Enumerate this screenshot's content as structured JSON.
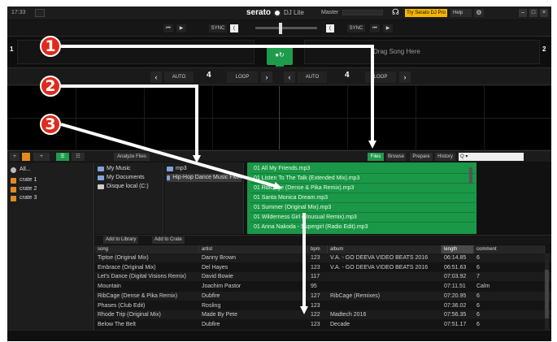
{
  "titlebar": {
    "time": "17:33",
    "brand": "serato",
    "product": "DJ Lite",
    "master_label": "Master",
    "try_pro": "Try Serato DJ Pro",
    "help": "Help",
    "icons": [
      "headphones-icon",
      "gear-icon",
      "minimize-icon",
      "maximize-icon",
      "close-icon"
    ]
  },
  "deck_strip": {
    "left_sync": "SYNC",
    "right_sync": "SYNC"
  },
  "decks": {
    "left_number": "1",
    "right_number": "2",
    "right_title": "Drag Song Here"
  },
  "controls": {
    "left_auto": "AUTO",
    "left_value": "4",
    "left_loop": "LOOP",
    "right_auto": "AUTO",
    "right_value": "4",
    "right_loop": "LOOP"
  },
  "library_toolbar": {
    "analyze": "Analyze Files",
    "files": "Files",
    "browse": "Browse",
    "prepare": "Prepare",
    "history": "History",
    "search_placeholder": "Q ▾"
  },
  "crates": {
    "items": [
      {
        "label": "All...",
        "icon": "all-icon"
      },
      {
        "label": "crate 1",
        "icon": "crate-icon"
      },
      {
        "label": "crate 2",
        "icon": "crate-icon"
      },
      {
        "label": "crate 3",
        "icon": "crate-icon"
      }
    ]
  },
  "files_left": {
    "items": [
      "My Music",
      "My Documents",
      "Disque local (C:)"
    ]
  },
  "files_mid": {
    "items": [
      "mp3",
      "Hip-Hop Dance Music FMA"
    ]
  },
  "files_green": {
    "items": [
      "01 All My Friends.mp3",
      "01 Listen To The Talk (Extended Mix).mp3",
      "01 RibCage (Dense & Pika Remix).mp3",
      "01 Santa Monica Dream.mp3",
      "01 Summer (Original Mix).mp3",
      "01 Wilderness Girl (Unusual Remix).mp3",
      "01 Anna Nakoda - Supergirl (Radio Edit).mp3"
    ]
  },
  "view_bar": {
    "add_to_library": "Add to Library",
    "add_to_crate": "Add to Crate"
  },
  "table": {
    "headers": [
      "song",
      "artist",
      "bpm",
      "album",
      "length",
      "comment"
    ],
    "rows": [
      [
        "Tiptoe (Original Mix)",
        "Danny Brown",
        "123",
        "V.A. - GO DEEVA VIDEO BEATS 2016",
        "06:14.85",
        "6"
      ],
      [
        "Embrace (Original Mix)",
        "Del Hayes",
        "123",
        "V.A. - GO DEEVA VIDEO BEATS 2016",
        "06:51.63",
        "6"
      ],
      [
        "Let's Dance (Digital Visions Remix)",
        "David Bowie",
        "117",
        "",
        "07:03.92",
        "7"
      ],
      [
        "Mountain",
        "Joachim Pastor",
        "95",
        "",
        "07:11.51",
        "Calm"
      ],
      [
        "RibCage (Dense & Pika Remix)",
        "Dubfire",
        "127",
        "RibCage (Remixes)",
        "07:20.95",
        "6"
      ],
      [
        "Phases (Club Edit)",
        "Rosling",
        "123",
        "",
        "07:36.02",
        "6"
      ],
      [
        "Rhode Trip (Original Mix)",
        "Made By Pete",
        "122",
        "Madtech 2016",
        "07:56.35",
        "6"
      ],
      [
        "Below The Belt",
        "Dubfire",
        "123",
        "Decade",
        "07:51.17",
        "6"
      ]
    ]
  },
  "callouts": [
    "1",
    "2",
    "3"
  ],
  "colors": {
    "accent_green": "#1e9c4c",
    "try_pro_yellow": "#f4b400",
    "callout_red": "#e02a1c"
  }
}
